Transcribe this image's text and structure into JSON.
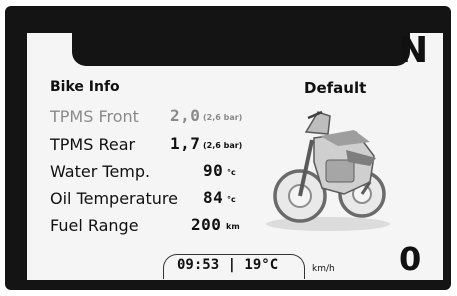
{
  "display": {
    "gear": "N",
    "mode": "Default",
    "section_title": "Bike Info",
    "rows": [
      {
        "label": "TPMS Front",
        "value": "2,0",
        "unit": "(2,6 bar)",
        "dimmed": true
      },
      {
        "label": "TPMS Rear",
        "value": "1,7",
        "unit": "(2,6 bar)",
        "dimmed": false
      },
      {
        "label": "Water Temp.",
        "value": "90",
        "unit": "°c",
        "dimmed": false
      },
      {
        "label": "Oil Temperature",
        "value": "84",
        "unit": "°c",
        "dimmed": false
      },
      {
        "label": "Fuel Range",
        "value": "200",
        "unit": "km",
        "dimmed": false
      }
    ],
    "clock": "09:53 | 19°C",
    "speed_unit": "km/h",
    "trip_indicator": "0"
  },
  "colors": {
    "bezel": "#141414",
    "screen": "#f5f5f5",
    "dimmed_text": "#8a8a8a"
  }
}
